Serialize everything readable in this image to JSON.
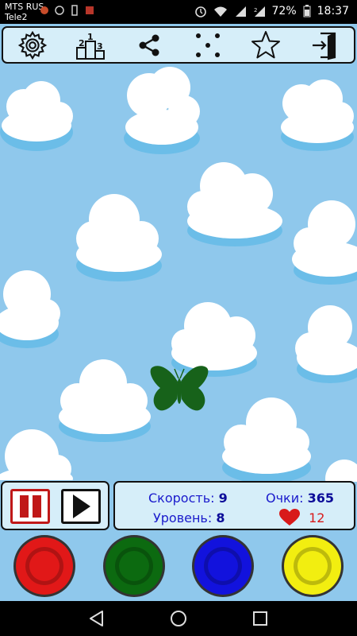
{
  "status_bar": {
    "carrier_1": "MTS RUS",
    "carrier_2": "Tele2",
    "battery": "72%",
    "time": "18:37"
  },
  "toolbar": {
    "items": [
      {
        "name": "settings",
        "icon": "gear-icon"
      },
      {
        "name": "leaderboard",
        "icon": "podium-icon",
        "places": [
          "2",
          "1",
          "3"
        ]
      },
      {
        "name": "share",
        "icon": "share-icon"
      },
      {
        "name": "more-games",
        "icon": "dots-icon"
      },
      {
        "name": "rate",
        "icon": "star-icon"
      },
      {
        "name": "exit",
        "icon": "exit-door-icon"
      }
    ]
  },
  "hud": {
    "speed_label": "Скорость:",
    "speed_value": "9",
    "score_label": "Очки:",
    "score_value": "365",
    "level_label": "Уровень:",
    "level_value": "8",
    "lives_value": "12"
  },
  "butterfly": {
    "color": "#17621a"
  },
  "colors": {
    "sky": "#8fc8ec",
    "panel": "#d6eef9",
    "label": "#1a1acc",
    "heart": "#d81a1a",
    "pause": "#c01818"
  },
  "color_buttons": [
    {
      "name": "red",
      "color": "#e11818"
    },
    {
      "name": "green",
      "color": "#0c6a10"
    },
    {
      "name": "blue",
      "color": "#1212dd"
    },
    {
      "name": "yellow",
      "color": "#f2ee10"
    }
  ]
}
